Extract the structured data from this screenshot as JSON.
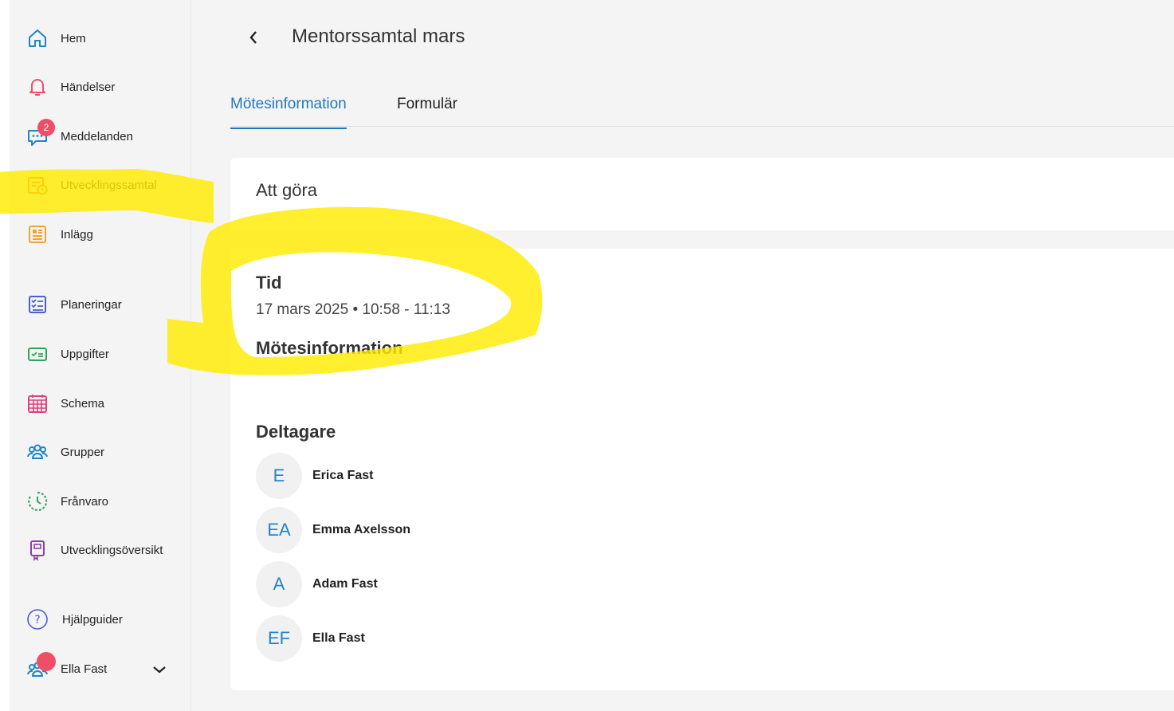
{
  "sidebar": {
    "items": [
      {
        "label": "Hem",
        "icon": "home-icon"
      },
      {
        "label": "Händelser",
        "icon": "bell-icon"
      },
      {
        "label": "Meddelanden",
        "icon": "chat-icon",
        "badge": "2"
      },
      {
        "label": "Utvecklingssamtal",
        "icon": "calendar-clock-icon"
      },
      {
        "label": "Inlägg",
        "icon": "news-icon"
      },
      {
        "label": "Planeringar",
        "icon": "checklist-icon"
      },
      {
        "label": "Uppgifter",
        "icon": "task-icon"
      },
      {
        "label": "Schema",
        "icon": "schedule-icon"
      },
      {
        "label": "Grupper",
        "icon": "group-icon"
      },
      {
        "label": "Frånvaro",
        "icon": "absence-icon"
      },
      {
        "label": "Utvecklingsöversikt",
        "icon": "overview-icon"
      },
      {
        "label": "Hjälpguider",
        "icon": "help-icon"
      }
    ],
    "user": {
      "name": "Ella Fast",
      "icon": "user-group-icon"
    }
  },
  "header": {
    "title": "Mentorssamtal mars"
  },
  "tabs": [
    {
      "label": "Mötesinformation",
      "active": true
    },
    {
      "label": "Formulär",
      "active": false
    }
  ],
  "todo": {
    "heading": "Att göra"
  },
  "meeting": {
    "time_heading": "Tid",
    "time": "17 mars 2025 • 10:58 - 11:13",
    "info_heading": "Mötesinformation",
    "participants_heading": "Deltagare",
    "participants": [
      {
        "initials": "E",
        "name": "Erica Fast"
      },
      {
        "initials": "EA",
        "name": "Emma Axelsson"
      },
      {
        "initials": "A",
        "name": "Adam Fast"
      },
      {
        "initials": "EF",
        "name": "Ella Fast"
      }
    ]
  },
  "colors": {
    "accent": "#1f79bf",
    "badge": "#ef4f66",
    "highlight": "#ffeb00"
  }
}
